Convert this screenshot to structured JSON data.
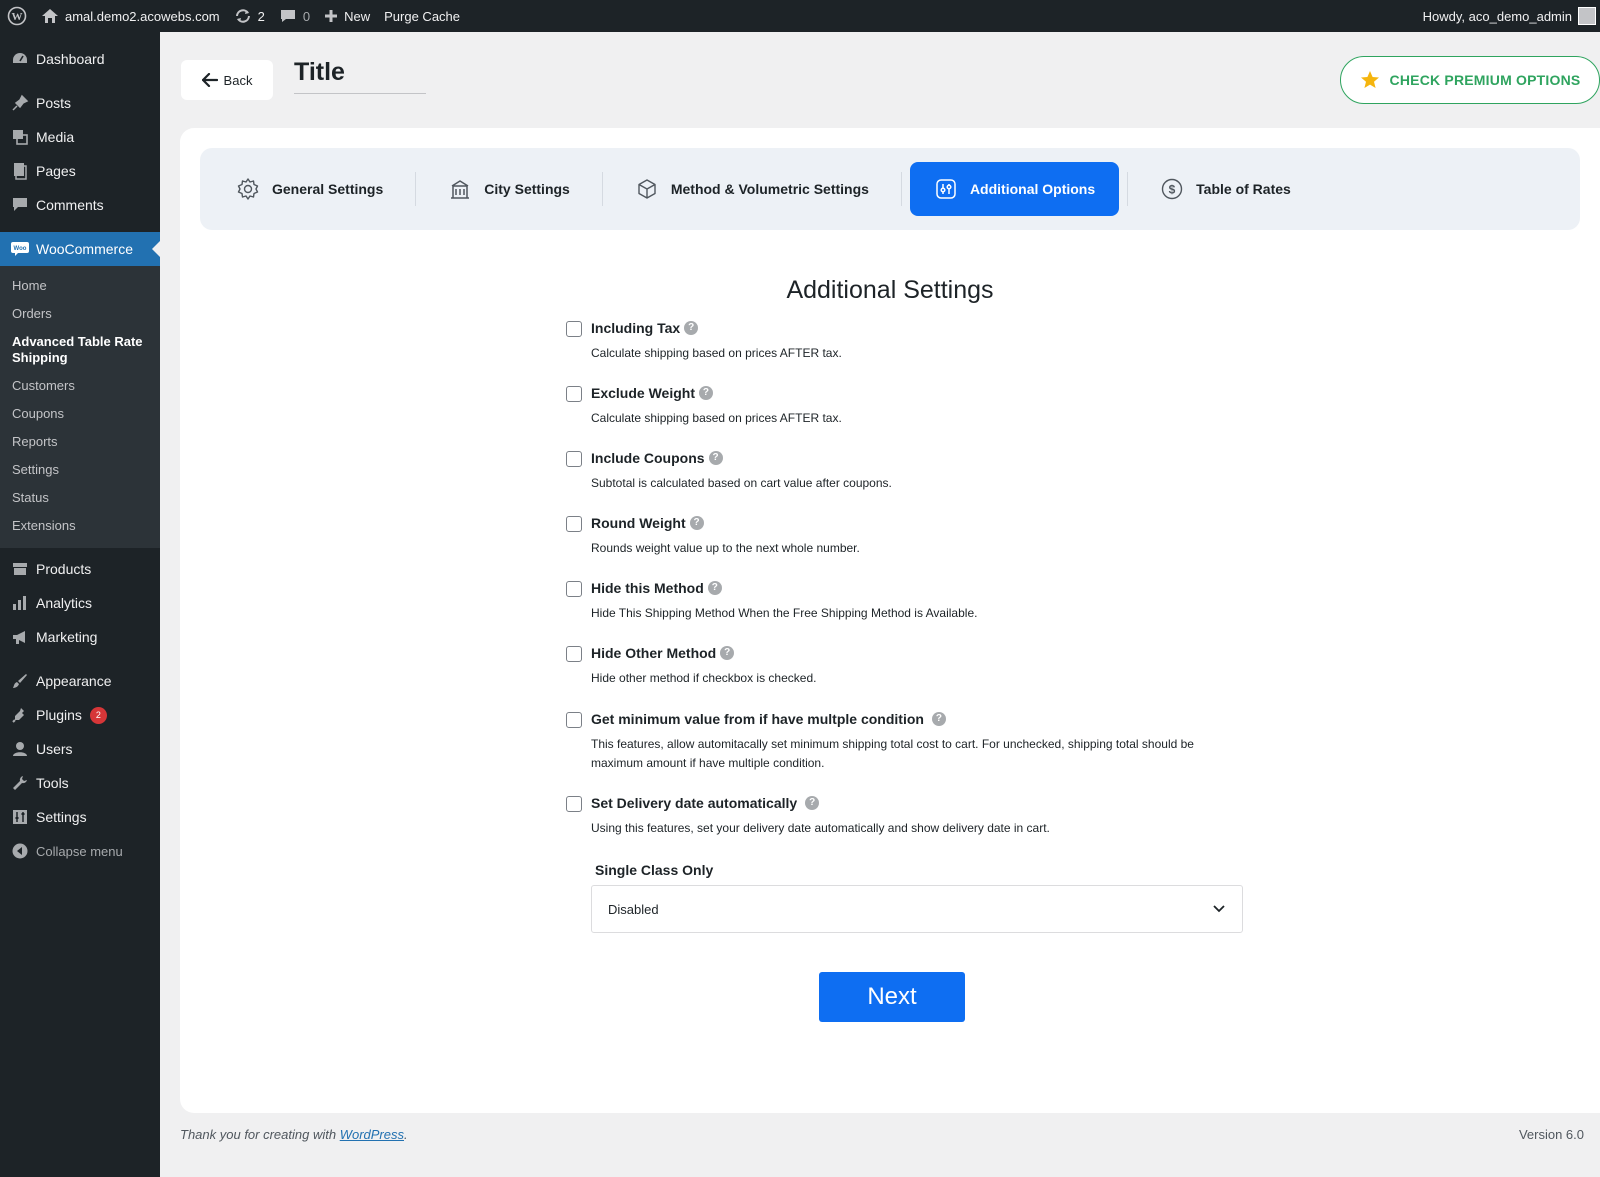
{
  "admin_bar": {
    "site_name": "amal.demo2.acowebs.com",
    "updates_count": "2",
    "comments_count": "0",
    "new_label": "New",
    "purge_label": "Purge Cache",
    "howdy": "Howdy, aco_demo_admin"
  },
  "sidebar": {
    "dashboard": "Dashboard",
    "posts": "Posts",
    "media": "Media",
    "pages": "Pages",
    "comments": "Comments",
    "woocommerce": "WooCommerce",
    "woo_sub": [
      "Home",
      "Orders",
      "Advanced Table Rate Shipping",
      "Customers",
      "Coupons",
      "Reports",
      "Settings",
      "Status",
      "Extensions"
    ],
    "products": "Products",
    "analytics": "Analytics",
    "marketing": "Marketing",
    "appearance": "Appearance",
    "plugins": "Plugins",
    "plugins_badge": "2",
    "users": "Users",
    "tools": "Tools",
    "settings": "Settings",
    "collapse": "Collapse menu"
  },
  "header": {
    "back_label": "Back",
    "title": "Title",
    "premium_label": "CHECK PREMIUM OPTIONS"
  },
  "tabs": [
    {
      "label": "General Settings",
      "icon": "gear-icon"
    },
    {
      "label": "City Settings",
      "icon": "building-icon"
    },
    {
      "label": "Method & Volumetric Settings",
      "icon": "box-icon"
    },
    {
      "label": "Additional Options",
      "icon": "sliders-icon",
      "active": true
    },
    {
      "label": "Table of Rates",
      "icon": "dollar-icon"
    }
  ],
  "section": {
    "title": "Additional Settings",
    "options": [
      {
        "label": "Including Tax",
        "desc": "Calculate shipping based on prices AFTER tax.",
        "checked": false
      },
      {
        "label": "Exclude Weight",
        "desc": "Calculate shipping based on prices AFTER tax.",
        "checked": false
      },
      {
        "label": "Include Coupons",
        "desc": "Subtotal is calculated based on cart value after coupons.",
        "checked": false
      },
      {
        "label": "Round Weight",
        "desc": "Rounds weight value up to the next whole number.",
        "checked": false
      },
      {
        "label": "Hide this Method",
        "desc": "Hide This Shipping Method When the Free Shipping Method is Available.",
        "checked": false
      },
      {
        "label": "Hide Other Method",
        "desc": "Hide other method if checkbox is checked.",
        "checked": false
      },
      {
        "label": "Get minimum value from if have multple condition",
        "desc": "This features, allow automitacally set minimum shipping total cost to cart. For unchecked, shipping total should be maximum amount if have multiple condition.",
        "checked": false
      },
      {
        "label": "Set Delivery date automatically",
        "desc": "Using this features, set your delivery date automatically and show delivery date in cart.",
        "checked": false
      }
    ],
    "single_class_label": "Single Class Only",
    "single_class_value": "Disabled",
    "next_label": "Next"
  },
  "footer": {
    "thanks_prefix": "Thank you for creating with ",
    "wordpress_link": "WordPress",
    "thanks_suffix": ".",
    "version": "Version 6.0"
  },
  "colors": {
    "accent": "#0e6ef2",
    "premium": "#2fa45f",
    "admin_dark": "#1d2327",
    "wp_blue": "#2271b1"
  }
}
